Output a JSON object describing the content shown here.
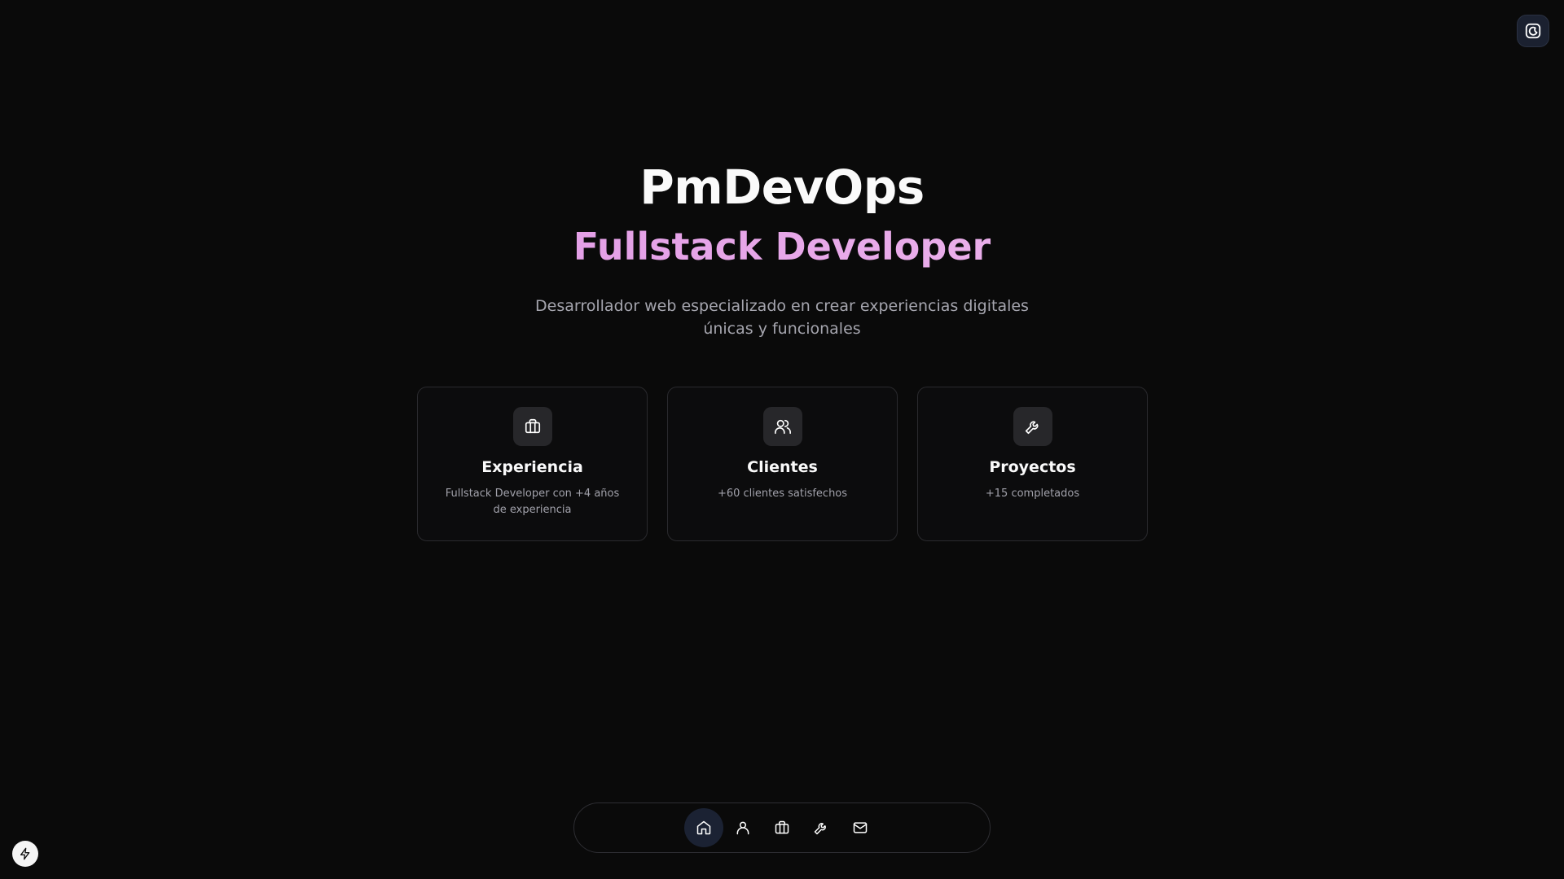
{
  "header": {
    "theme_toggle_icon": "moon-icon"
  },
  "hero": {
    "title": "PmDevOps",
    "subtitle": "Fullstack Developer",
    "description": "Desarrollador web especializado en crear experiencias digitales únicas y funcionales",
    "subtitle_gradient": [
      "#d78ee0",
      "#f2c4f0"
    ]
  },
  "cards": [
    {
      "icon": "briefcase-icon",
      "title": "Experiencia",
      "text": "Fullstack Developer con +4 años de experiencia"
    },
    {
      "icon": "users-icon",
      "title": "Clientes",
      "text": "+60 clientes satisfechos"
    },
    {
      "icon": "wrench-icon",
      "title": "Proyectos",
      "text": "+15 completados"
    }
  ],
  "dock": {
    "items": [
      {
        "icon": "home-icon",
        "active": true
      },
      {
        "icon": "user-icon",
        "active": false
      },
      {
        "icon": "briefcase-icon",
        "active": false
      },
      {
        "icon": "wrench-icon",
        "active": false
      },
      {
        "icon": "mail-icon",
        "active": false
      }
    ]
  },
  "corner_badge": {
    "icon": "bolt-icon"
  },
  "colors": {
    "background": "#0a0a0a",
    "accent": "#e6a4e8",
    "muted_text": "#a1a1aa",
    "card_border": "#2a2a2e",
    "active_dock": "#1b2233"
  }
}
